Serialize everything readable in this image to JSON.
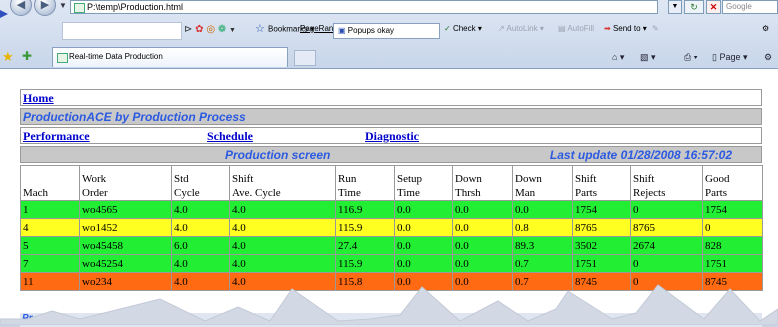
{
  "browser": {
    "address": "P:\\temp\\Production.html",
    "search_placeholder": "Google",
    "tab_title": "Real-time Data Production",
    "toolbar": {
      "bookmarks": "Bookmarks",
      "pagerank": "PageRank",
      "popups": "Popups okay",
      "check": "Check",
      "autolink": "AutoLink",
      "autofill": "AutoFill",
      "sendto": "Send to"
    },
    "command_page": "Page"
  },
  "page": {
    "home": "Home",
    "app_name": "ProductionACE by Production Process",
    "nav": [
      "Performance",
      "Schedule",
      "Diagnostic"
    ],
    "screen_title": "Production screen",
    "last_update": "Last update 01/28/2008 16:57:02",
    "cut_label": "Pr",
    "columns": [
      {
        "line1": "",
        "line2": "Mach"
      },
      {
        "line1": "Work",
        "line2": "Order"
      },
      {
        "line1": "Std",
        "line2": "Cycle"
      },
      {
        "line1": "Shift",
        "line2": "Ave. Cycle"
      },
      {
        "line1": "Run",
        "line2": "Time"
      },
      {
        "line1": "Setup",
        "line2": "Time"
      },
      {
        "line1": "Down",
        "line2": "Thrsh"
      },
      {
        "line1": "Down",
        "line2": "Man"
      },
      {
        "line1": "Shift",
        "line2": "Parts"
      },
      {
        "line1": "Shift",
        "line2": "Rejects"
      },
      {
        "line1": "Good",
        "line2": "Parts"
      }
    ],
    "rows": [
      {
        "status": "green",
        "cells": [
          "1",
          "wo4565",
          "4.0",
          "4.0",
          "116.9",
          "0.0",
          "0.0",
          "0.0",
          "1754",
          "0",
          "1754"
        ]
      },
      {
        "status": "yellow",
        "cells": [
          "4",
          "wo1452",
          "4.0",
          "4.0",
          "115.9",
          "0.0",
          "0.0",
          "0.8",
          "8765",
          "8765",
          "0"
        ]
      },
      {
        "status": "green",
        "cells": [
          "5",
          "wo45458",
          "6.0",
          "4.0",
          "27.4",
          "0.0",
          "0.0",
          "89.3",
          "3502",
          "2674",
          "828"
        ]
      },
      {
        "status": "green",
        "cells": [
          "7",
          "wo45254",
          "4.0",
          "4.0",
          "115.9",
          "0.0",
          "0.0",
          "0.7",
          "1751",
          "0",
          "1751"
        ]
      },
      {
        "status": "orange",
        "cells": [
          "11",
          "wo234",
          "4.0",
          "4.0",
          "115.8",
          "0.0",
          "0.0",
          "0.7",
          "8745",
          "0",
          "8745"
        ]
      }
    ]
  },
  "colors": {
    "status_green": "#22ee33",
    "status_yellow": "#ffff22",
    "status_orange": "#ff6a12",
    "header_text": "#2c5ae0"
  }
}
